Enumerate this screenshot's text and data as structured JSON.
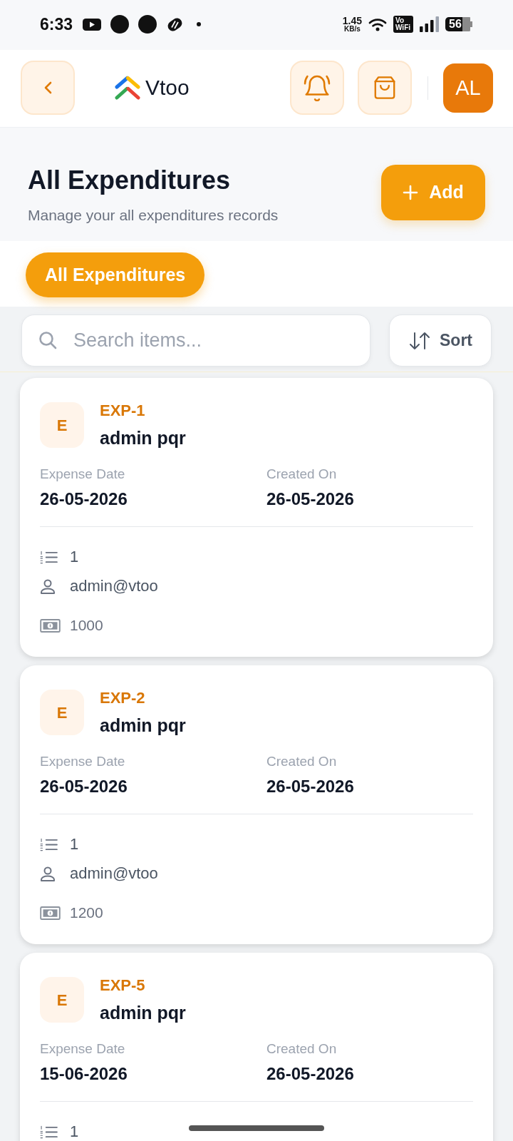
{
  "status_bar": {
    "time": "6:33",
    "network_speed": "1.45",
    "network_unit": "KB/s",
    "call_badge": "Vo WiFi",
    "battery": "56"
  },
  "header": {
    "logo": "Vtoo",
    "avatar": "AL"
  },
  "page_header": {
    "title": "All Expenditures",
    "subtitle": "Manage your all expenditures records",
    "add_button": "Add"
  },
  "tabs": [
    {
      "label": "All Expenditures",
      "selected": true
    }
  ],
  "toolbar": {
    "search": {
      "placeholder": "Search items..."
    },
    "sort_button": "Sort"
  },
  "records": [
    {
      "avatar": "E",
      "code": "EXP-1",
      "name": "admin pqr",
      "fields": [
        {
          "label": "Expense Date",
          "value": "26-05-2026"
        },
        {
          "label": "Created On",
          "value": "26-05-2026"
        }
      ],
      "details": [
        {
          "kind": "count",
          "text": "1"
        },
        {
          "kind": "user",
          "text": "admin@vtoo"
        },
        {
          "kind": "amount",
          "text": "1000"
        }
      ]
    },
    {
      "avatar": "E",
      "code": "EXP-2",
      "name": "admin pqr",
      "fields": [
        {
          "label": "Expense Date",
          "value": "26-05-2026"
        },
        {
          "label": "Created On",
          "value": "26-05-2026"
        }
      ],
      "details": [
        {
          "kind": "count",
          "text": "1"
        },
        {
          "kind": "user",
          "text": "admin@vtoo"
        },
        {
          "kind": "amount",
          "text": "1200"
        }
      ]
    },
    {
      "avatar": "E",
      "code": "EXP-5",
      "name": "admin pqr",
      "fields": [
        {
          "label": "Expense Date",
          "value": "15-06-2026"
        },
        {
          "label": "Created On",
          "value": "26-05-2026"
        }
      ],
      "details": [
        {
          "kind": "count",
          "text": "1"
        }
      ]
    }
  ]
}
